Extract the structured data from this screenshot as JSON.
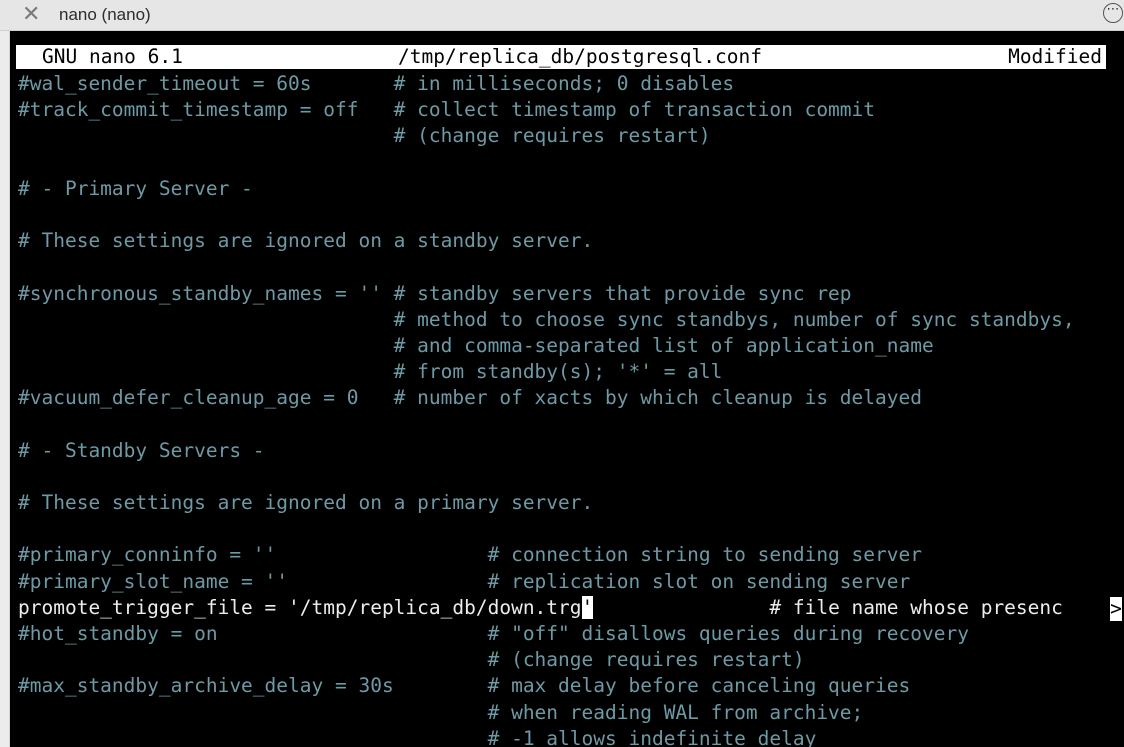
{
  "window": {
    "title": "nano (nano)",
    "close_icon": "close-x-icon",
    "more_icon": "more-options-icon",
    "more_glyph": "⋯"
  },
  "nano": {
    "version": "GNU nano 6.1",
    "filename": "/tmp/replica_db/postgresql.conf",
    "status": "Modified",
    "overflow_marker": ">"
  },
  "colors": {
    "comment": "#6d9aa5",
    "active_text": "#ececec",
    "header_bg": "#ffffff",
    "background": "#000000"
  },
  "lines": [
    {
      "text": "#wal_sender_timeout = 60s       # in milliseconds; 0 disables",
      "style": "comment"
    },
    {
      "text": "#track_commit_timestamp = off   # collect timestamp of transaction commit",
      "style": "comment"
    },
    {
      "text": "                                # (change requires restart)",
      "style": "comment"
    },
    {
      "text": "",
      "style": "comment"
    },
    {
      "text": "# - Primary Server -",
      "style": "comment"
    },
    {
      "text": "",
      "style": "comment"
    },
    {
      "text": "# These settings are ignored on a standby server.",
      "style": "comment"
    },
    {
      "text": "",
      "style": "comment"
    },
    {
      "text": "#synchronous_standby_names = '' # standby servers that provide sync rep",
      "style": "comment"
    },
    {
      "text": "                                # method to choose sync standbys, number of sync standbys,",
      "style": "comment"
    },
    {
      "text": "                                # and comma-separated list of application_name",
      "style": "comment"
    },
    {
      "text": "                                # from standby(s); '*' = all",
      "style": "comment"
    },
    {
      "text": "#vacuum_defer_cleanup_age = 0   # number of xacts by which cleanup is delayed",
      "style": "comment"
    },
    {
      "text": "",
      "style": "comment"
    },
    {
      "text": "# - Standby Servers -",
      "style": "comment"
    },
    {
      "text": "",
      "style": "comment"
    },
    {
      "text": "# These settings are ignored on a primary server.",
      "style": "comment"
    },
    {
      "text": "",
      "style": "comment"
    },
    {
      "text": "#primary_conninfo = ''                  # connection string to sending server",
      "style": "comment"
    },
    {
      "text": "#primary_slot_name = ''                 # replication slot on sending server",
      "style": "comment"
    },
    {
      "text": "promote_trigger_file = '/tmp/replica_db/down.trg",
      "cursor_char": "'",
      "after_cursor": "               # file name whose presenc",
      "style": "plain"
    },
    {
      "text": "#hot_standby = on                       # \"off\" disallows queries during recovery",
      "style": "comment"
    },
    {
      "text": "                                        # (change requires restart)",
      "style": "comment"
    },
    {
      "text": "#max_standby_archive_delay = 30s        # max delay before canceling queries",
      "style": "comment"
    },
    {
      "text": "                                        # when reading WAL from archive;",
      "style": "comment"
    },
    {
      "text": "                                        # -1 allows indefinite delay",
      "style": "comment"
    }
  ]
}
